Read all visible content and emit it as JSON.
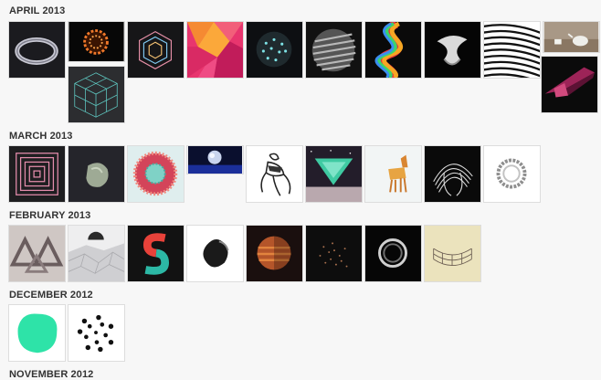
{
  "sections": [
    {
      "label": "APRIL 2013"
    },
    {
      "label": "MARCH 2013"
    },
    {
      "label": "FEBRUARY 2013"
    },
    {
      "label": "DECEMBER 2012"
    },
    {
      "label": "NOVEMBER 2012"
    }
  ]
}
